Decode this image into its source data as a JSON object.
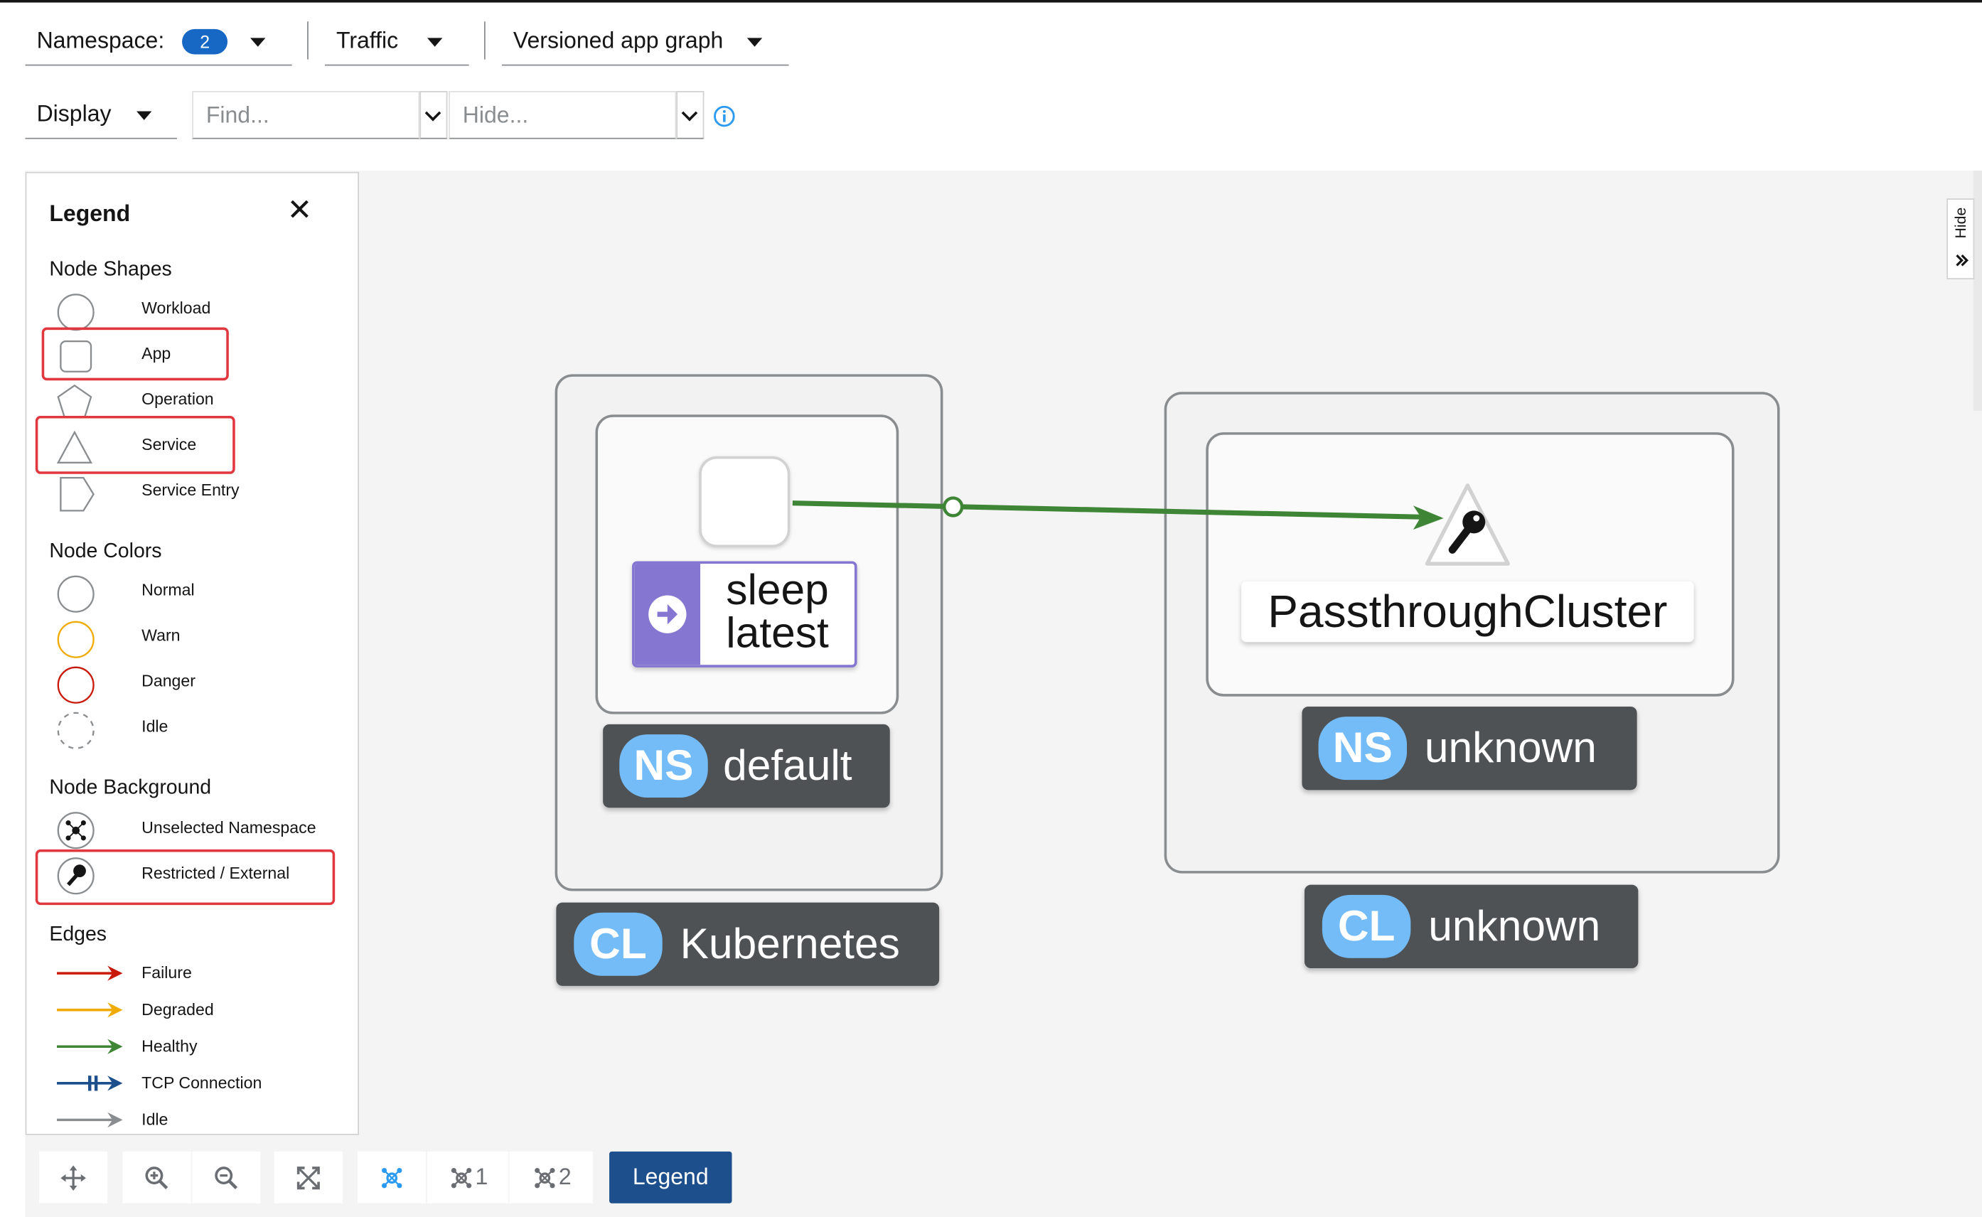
{
  "toolbar": {
    "namespace_label": "Namespace:",
    "namespace_count": "2",
    "traffic_label": "Traffic",
    "graph_type_label": "Versioned app graph",
    "display_label": "Display",
    "find_placeholder": "Find...",
    "hide_placeholder": "Hide..."
  },
  "legend": {
    "title": "Legend",
    "sections": {
      "node_shapes": "Node Shapes",
      "node_colors": "Node Colors",
      "node_background": "Node Background",
      "edges": "Edges"
    },
    "shapes": [
      "Workload",
      "App",
      "Operation",
      "Service",
      "Service Entry"
    ],
    "colors": [
      "Normal",
      "Warn",
      "Danger",
      "Idle"
    ],
    "backgrounds": [
      "Unselected Namespace",
      "Restricted / External"
    ],
    "edges": [
      "Failure",
      "Degraded",
      "Healthy",
      "TCP Connection",
      "Idle"
    ],
    "colors_hex": {
      "normal": "#8a8d90",
      "warn": "#f0ab00",
      "danger": "#c9190b",
      "failure": "#c9190b",
      "degraded": "#f0ab00",
      "healthy": "#3e8635",
      "tcp": "#1d4f8c",
      "idle": "#8a8d90"
    }
  },
  "graph": {
    "app_node": {
      "name": "sleep",
      "version": "latest"
    },
    "service_node": {
      "name": "PassthroughCluster"
    },
    "namespaces": [
      {
        "badge": "NS",
        "name": "default"
      },
      {
        "badge": "NS",
        "name": "unknown"
      }
    ],
    "clusters": [
      {
        "badge": "CL",
        "name": "Kubernetes"
      },
      {
        "badge": "CL",
        "name": "unknown"
      }
    ],
    "edge_color": "#3e8635"
  },
  "hide_tab": "Hide",
  "bottom": {
    "layout1": "1",
    "layout2": "2",
    "legend_button": "Legend"
  }
}
